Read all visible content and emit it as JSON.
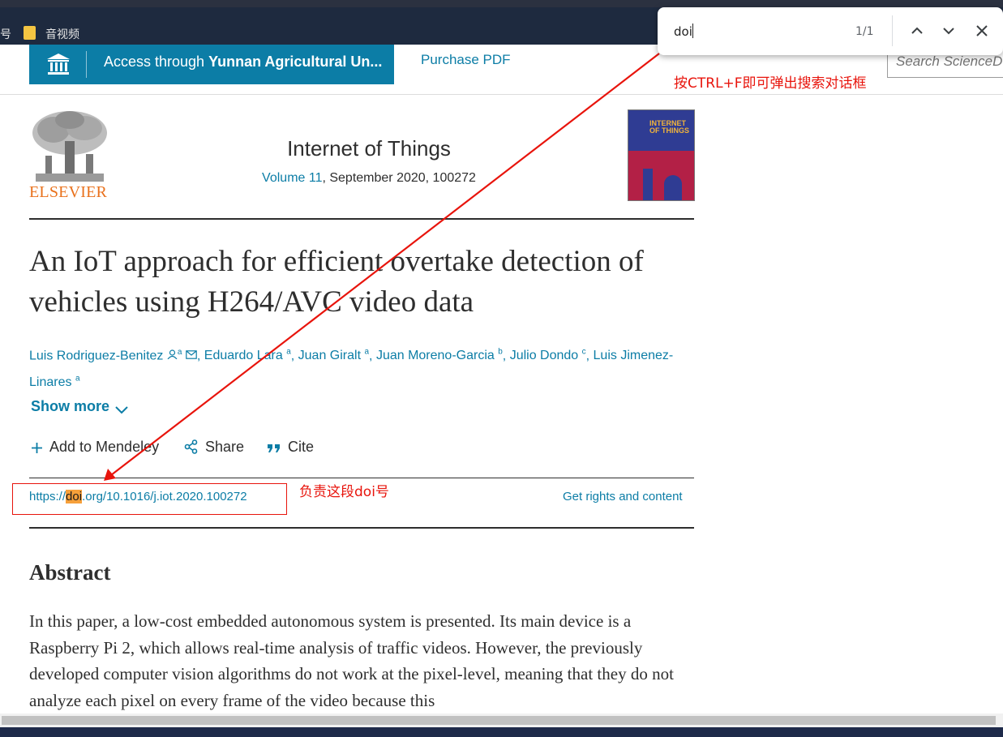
{
  "bookmarks": {
    "fragment": "号",
    "folder_label": "音视频"
  },
  "header": {
    "access_prefix": "Access through ",
    "access_institution": "Yunnan Agricultural Un...",
    "purchase_label": "Purchase PDF",
    "search_placeholder": "Search ScienceD"
  },
  "find_bar": {
    "query": "doi",
    "count": "1/1"
  },
  "annotations": {
    "find_note": "按CTRL+F即可弹出搜索对话框",
    "doi_note": "负责这段doi号"
  },
  "journal": {
    "publisher": "ELSEVIER",
    "name": "Internet of Things",
    "volume": "Volume 11",
    "issue_info": ", September 2020, 100272",
    "cover_title": "INTERNET OF THINGS"
  },
  "article": {
    "title": "An IoT approach for efficient overtake detection of vehicles using H264/AVC video data",
    "authors": [
      {
        "name": "Luis Rodriguez-Benitez",
        "aff": "a"
      },
      {
        "name": "Eduardo Lara",
        "aff": "a"
      },
      {
        "name": "Juan Giralt",
        "aff": "a"
      },
      {
        "name": "Juan Moreno-Garcia",
        "aff": "b"
      },
      {
        "name": "Julio Dondo",
        "aff": "c"
      },
      {
        "name": "Luis Jimenez-Linares",
        "aff": "a"
      }
    ],
    "show_more": "Show more",
    "actions": {
      "mendeley": "Add to Mendeley",
      "share": "Share",
      "cite": "Cite"
    },
    "doi_prefix": "https://",
    "doi_highlight": "doi",
    "doi_suffix": ".org/10.1016/j.iot.2020.100272",
    "rights": "Get rights and content",
    "abstract_heading": "Abstract",
    "abstract_text": "In this paper, a low-cost embedded autonomous system is presented. Its main device is a Raspberry Pi 2, which allows real-time analysis of traffic videos. However, the previously developed computer vision algorithms do not work at the pixel-level, meaning that they do not analyze each pixel on every frame of the video because this"
  },
  "colors": {
    "link": "#0c7da6",
    "access_bg": "#0c7da6",
    "annotation": "#e8140c",
    "find_highlight": "#f6a03a",
    "elsevier_orange": "#e9711c"
  }
}
